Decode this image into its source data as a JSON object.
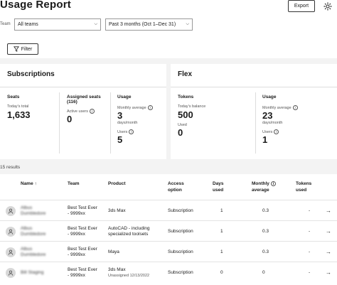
{
  "header": {
    "title": "Usage Report",
    "export_label": "Export",
    "team_label": "Team",
    "team_select": "All teams",
    "period_select": "Past 3 months (Oct 1–Dec 31)",
    "filter_label": "Filter"
  },
  "subscriptions": {
    "title": "Subscriptions",
    "seats": {
      "label": "Seats",
      "sub": "Today's total",
      "value": "1,633"
    },
    "assigned": {
      "label": "Assigned seats",
      "count": "(116)",
      "active_label": "Active users",
      "active_value": "0"
    },
    "usage": {
      "label": "Usage",
      "monthly_label": "Monthly average",
      "monthly_value": "3",
      "monthly_unit": "days/month",
      "users_label": "Users",
      "users_value": "5"
    }
  },
  "flex": {
    "title": "Flex",
    "tokens": {
      "label": "Tokens",
      "sub": "Today's balance",
      "value": "500",
      "used_label": "Used",
      "used_value": "0"
    },
    "usage": {
      "label": "Usage",
      "monthly_label": "Monthly average",
      "monthly_value": "23",
      "monthly_unit": "days/month",
      "users_label": "Users",
      "users_value": "1"
    }
  },
  "results_label": "15 results",
  "table": {
    "headers": {
      "name": "Name ↑",
      "team": "Team",
      "product": "Product",
      "access1": "Access",
      "access2": "option",
      "days1": "Days",
      "days2": "used",
      "monthly1": "Monthly",
      "monthly2": "average",
      "tokens1": "Tokens",
      "tokens2": "used"
    },
    "rows": [
      {
        "name1": "Albus",
        "name2": "Dumbledore",
        "team1": "Best Test Ever",
        "team2": "- 9999xx",
        "product1": "3ds Max",
        "product2": "",
        "access": "Subscription",
        "days": "1",
        "monthly": "0.3",
        "tokens": "-"
      },
      {
        "name1": "Albus",
        "name2": "Dumbledore",
        "team1": "Best Test Ever",
        "team2": "- 9999xx",
        "product1": "AutoCAD - including",
        "product2": "specialized toolsets",
        "access": "Subscription",
        "days": "1",
        "monthly": "0.3",
        "tokens": "-"
      },
      {
        "name1": "Albus",
        "name2": "Dumbledore",
        "team1": "Best Test Ever",
        "team2": "- 9999xx",
        "product1": "Maya",
        "product2": "",
        "access": "Subscription",
        "days": "1",
        "monthly": "0.3",
        "tokens": "-"
      },
      {
        "name1": "Bill Staging",
        "name2": "",
        "team1": "Best Test Ever",
        "team2": "- 9999xx",
        "product1": "3ds Max",
        "product2": "Unassigned 12/13/2022",
        "access": "Subscription",
        "days": "0",
        "monthly": "0",
        "tokens": "-"
      }
    ]
  }
}
